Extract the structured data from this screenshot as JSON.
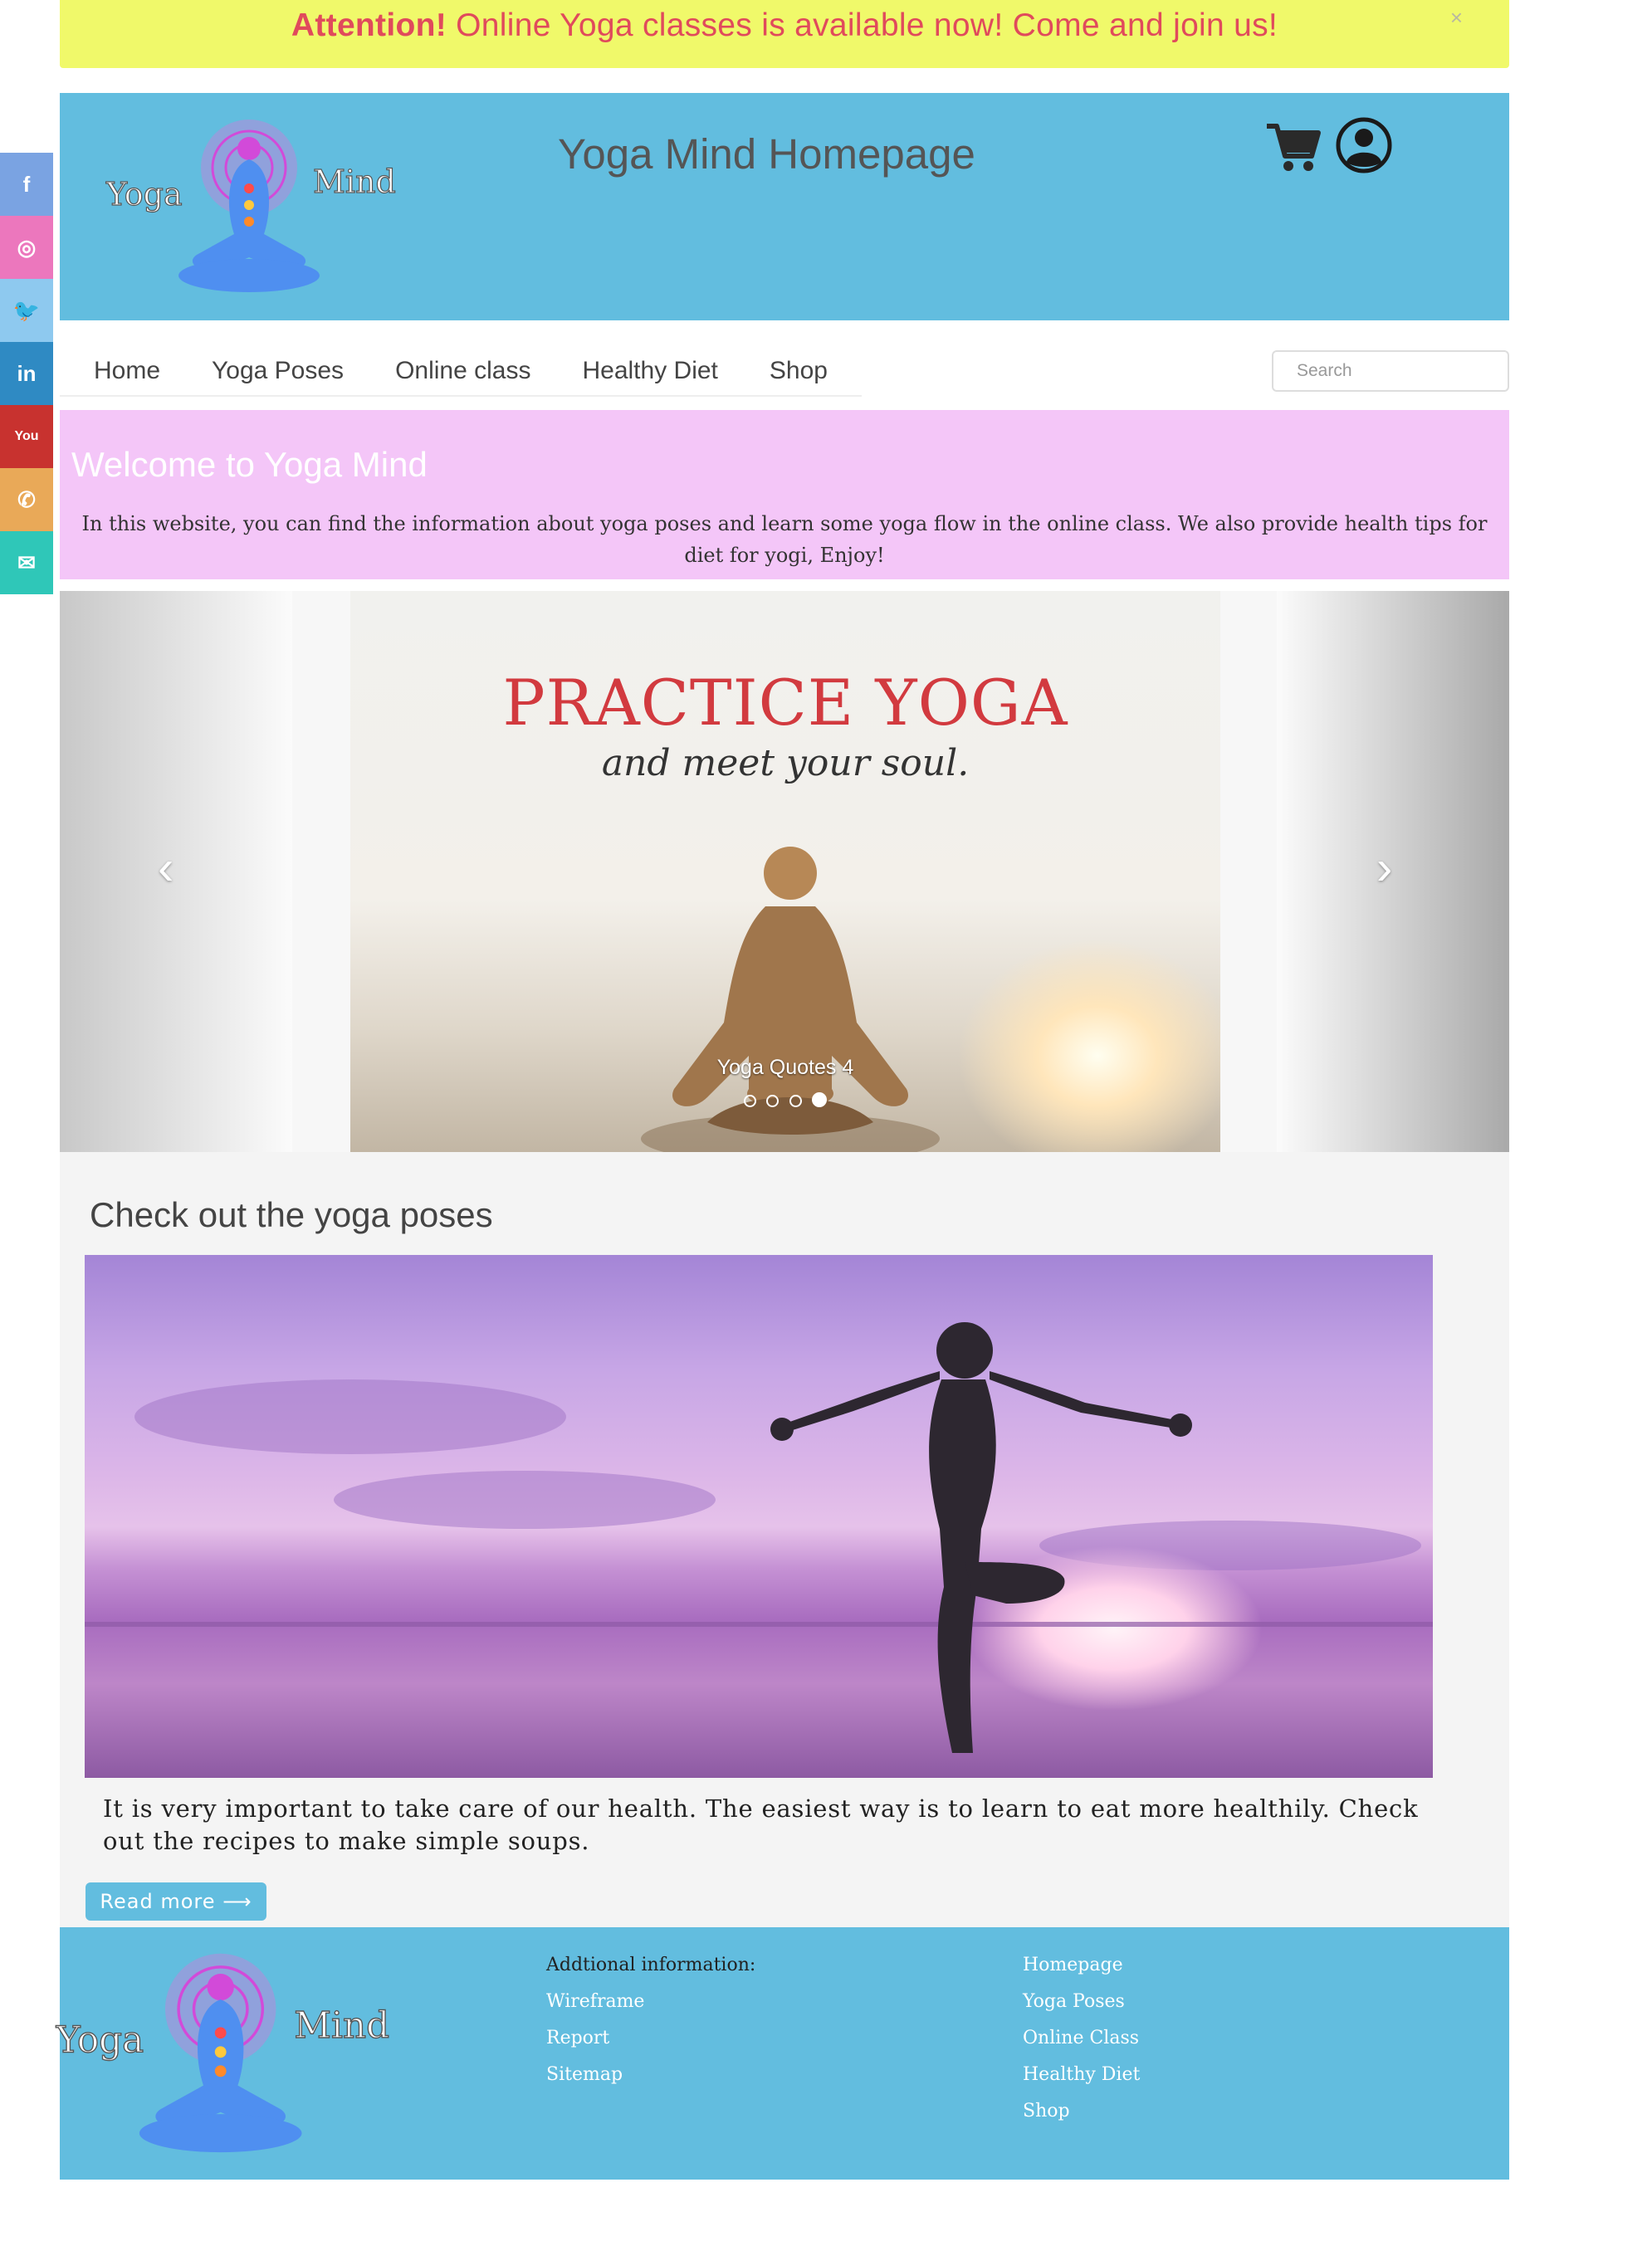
{
  "alert": {
    "strong": "Attention!",
    "message": " Online Yoga classes is available now! Come and join us!",
    "close_label": "×"
  },
  "header": {
    "logo_text_left": "Yoga",
    "logo_text_right": "Mind",
    "title": "Yoga Mind Homepage"
  },
  "nav": {
    "items": [
      {
        "label": "Home"
      },
      {
        "label": "Yoga Poses"
      },
      {
        "label": "Online class"
      },
      {
        "label": "Healthy Diet"
      },
      {
        "label": "Shop"
      }
    ],
    "search_placeholder": "Search"
  },
  "welcome": {
    "title": "Welcome to Yoga Mind",
    "text": "In this website, you can find the information about yoga poses and learn some yoga flow in the online class. We also provide health tips for diet for yogi, Enjoy!"
  },
  "carousel": {
    "headline": "PRACTICE YOGA",
    "subline": "and meet your soul.",
    "caption": "Yoga Quotes 4",
    "prev_label": "‹",
    "next_label": "›",
    "dot_count": 4,
    "active_index": 3
  },
  "poses": {
    "heading": "Check out the yoga poses",
    "text": "It is very important to take care of our health. The easiest way is to learn to eat more healthily. Check out the recipes to make simple soups.",
    "button_label": "Read more ⟶"
  },
  "footer": {
    "logo_text_left": "Yoga",
    "logo_text_right": "Mind",
    "col1_heading": "Addtional information:",
    "col1_links": [
      "Wireframe",
      "Report",
      "Sitemap"
    ],
    "col2_links": [
      "Homepage",
      "Yoga Poses",
      "Online Class",
      "Healthy Diet",
      "Shop"
    ]
  },
  "social": [
    {
      "icon": "facebook-icon",
      "glyph": "f",
      "color": "#7aa3e2"
    },
    {
      "icon": "instagram-icon",
      "glyph": "◎",
      "color": "#ec77bd"
    },
    {
      "icon": "twitter-icon",
      "glyph": "🐦",
      "color": "#8ec9ef"
    },
    {
      "icon": "linkedin-icon",
      "glyph": "in",
      "color": "#2f8ac3"
    },
    {
      "icon": "youtube-icon",
      "glyph": "You",
      "color": "#c8322f"
    },
    {
      "icon": "phone-icon",
      "glyph": "✆",
      "color": "#e9a958"
    },
    {
      "icon": "email-icon",
      "glyph": "✉",
      "color": "#2fc7b8"
    }
  ],
  "colors": {
    "alert_bg": "#f0f96a",
    "alert_text": "#e04a5c",
    "header_bg": "#62bddf",
    "welcome_bg": "#f4c6f8",
    "slide_headline": "#d23a3f"
  }
}
